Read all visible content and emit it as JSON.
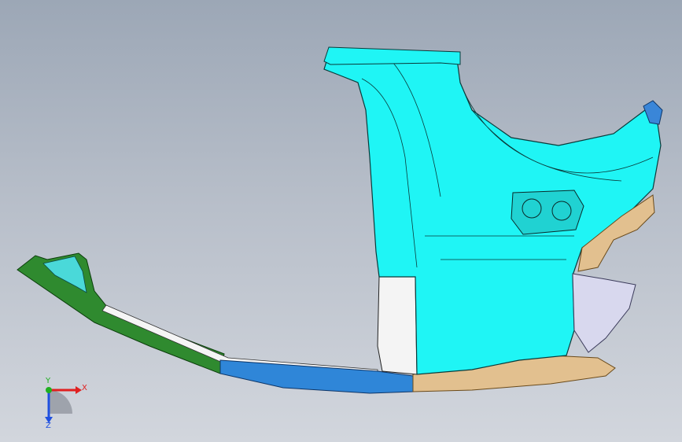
{
  "viewport": {
    "background_top": "#9ca7b6",
    "background_bottom": "#d2d6dd"
  },
  "model": {
    "parts": [
      {
        "name": "side-panel-outer",
        "color": "#1ff5f5"
      },
      {
        "name": "a-pillar-lower-green",
        "color": "#2f8a2f"
      },
      {
        "name": "rocker-front-blue",
        "color": "#2f86d8"
      },
      {
        "name": "rocker-rear-tan",
        "color": "#e2c08f"
      },
      {
        "name": "b-pillar-white",
        "color": "#f2f2f2"
      },
      {
        "name": "rear-bumper-bracket",
        "color": "#e2c08f"
      },
      {
        "name": "rear-lower-panel",
        "color": "#d8d8ee"
      },
      {
        "name": "hinge-bracket",
        "color": "#3a86d8"
      }
    ]
  },
  "triad": {
    "x_label": "X",
    "y_label": "Y",
    "z_label": "Z",
    "x_color": "#e02020",
    "y_color": "#20b020",
    "z_color": "#2050e0"
  }
}
